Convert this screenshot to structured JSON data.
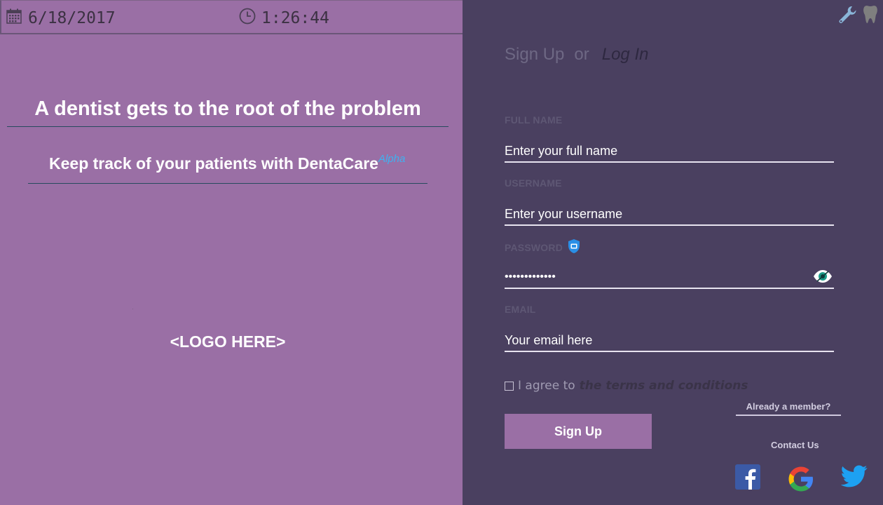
{
  "topbar": {
    "date": "6/18/2017",
    "time": "1:26:44",
    "date_icon": "calendar-icon",
    "time_icon": "clock-icon"
  },
  "hero": {
    "headline": "A dentist gets to the root of the problem",
    "tagline": "Keep track of your patients with",
    "brand": "DentaCare",
    "brand_badge": "Alpha",
    "logo_placeholder": "<LOGO HERE>"
  },
  "toolbar": {
    "icons": [
      "wrench-icon",
      "tooth-icon"
    ]
  },
  "auth": {
    "signup_tab": "Sign Up",
    "or_text": "or",
    "login_tab": "Log In"
  },
  "form": {
    "full_name": {
      "label": "FULL NAME",
      "placeholder": "Enter your full name"
    },
    "username": {
      "label": "USERNAME",
      "placeholder": "Enter your username"
    },
    "password": {
      "label": "PASSWORD",
      "value": "•••••••••••••",
      "badge_icon": "shield-lock-icon",
      "toggle_icon": "eye-icon"
    },
    "email": {
      "label": "EMAIL",
      "placeholder": "Your email here"
    },
    "terms_prefix": "I agree to",
    "terms_link": "the terms and conditions",
    "submit": "Sign Up"
  },
  "footer": {
    "already_member": "Already a member?",
    "contact": "Contact Us",
    "social_icons": [
      "facebook-icon",
      "google-icon",
      "twitter-icon"
    ]
  },
  "colors": {
    "left_panel": "#9a6fa5",
    "right_panel": "#4a4060",
    "brand_badge": "#3fb1f0",
    "button": "#9a6fa5"
  }
}
